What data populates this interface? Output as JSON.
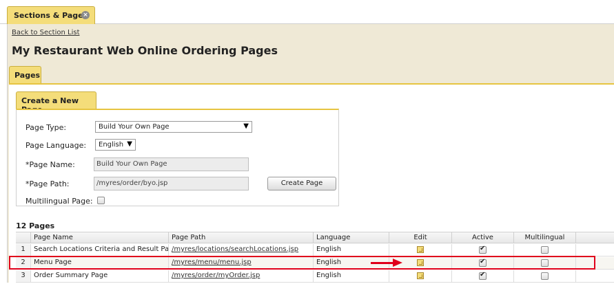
{
  "main_tab": {
    "label": "Sections & Pages",
    "close_icon": "close-icon"
  },
  "back_link": "Back to Section List",
  "page_title": "My Restaurant Web Online Ordering Pages",
  "pages_tab": {
    "label": "Pages"
  },
  "create_panel": {
    "tab_label": "Create a New Page",
    "page_type_label": "Page Type:",
    "page_type_value": "Build Your Own Page",
    "page_language_label": "Page Language:",
    "page_language_value": "English",
    "page_name_label": "*Page Name:",
    "page_name_value": "Build Your Own Page",
    "page_path_label": "*Page Path:",
    "page_path_value": "/myres/order/byo.jsp",
    "create_button": "Create Page",
    "multilingual_label": "Multilingual Page:",
    "multilingual_checked": false
  },
  "table": {
    "count_label": "12 Pages",
    "headers": [
      "",
      "Page Name",
      "Page Path",
      "Language",
      "Edit",
      "Active",
      "Multilingual"
    ],
    "rows": [
      {
        "num": "1",
        "name": "Search Locations Criteria and Result Page",
        "path": "/myres/locations/searchLocations.jsp",
        "language": "English",
        "active": true,
        "multilingual": false
      },
      {
        "num": "2",
        "name": "Menu Page",
        "path": "/myres/menu/menu.jsp",
        "language": "English",
        "active": true,
        "multilingual": false
      },
      {
        "num": "3",
        "name": "Order Summary Page",
        "path": "/myres/order/myOrder.jsp",
        "language": "English",
        "active": true,
        "multilingual": false
      }
    ]
  },
  "annotation": {
    "highlight_color": "#e0001b"
  },
  "colors": {
    "tab_yellow": "#f4dd7a",
    "panel_bg": "#efe9d6",
    "accent_border": "#e6c440"
  }
}
